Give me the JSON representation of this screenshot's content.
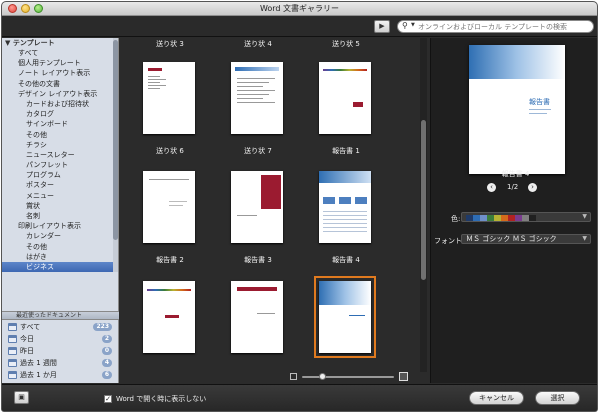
{
  "window": {
    "title": "Word 文書ギャラリー"
  },
  "toolbar": {
    "view_button_icon": "slideshow-icon",
    "search_placeholder": "オンラインおよびローカル テンプレートの検索"
  },
  "sidebar": {
    "header": "テンプレート",
    "items": [
      {
        "label": "すべて",
        "level": 1
      },
      {
        "label": "個人用テンプレート",
        "level": 1
      },
      {
        "label": "ノート レイアウト表示",
        "level": 1
      },
      {
        "label": "その他の文書",
        "level": 1
      },
      {
        "label": "デザイン レイアウト表示",
        "level": 1
      },
      {
        "label": "カードおよび招待状",
        "level": 2
      },
      {
        "label": "カタログ",
        "level": 2
      },
      {
        "label": "サインボード",
        "level": 2
      },
      {
        "label": "その他",
        "level": 2
      },
      {
        "label": "チラシ",
        "level": 2
      },
      {
        "label": "ニュースレター",
        "level": 2
      },
      {
        "label": "パンフレット",
        "level": 2
      },
      {
        "label": "プログラム",
        "level": 2
      },
      {
        "label": "ポスター",
        "level": 2
      },
      {
        "label": "メニュー",
        "level": 2
      },
      {
        "label": "賞状",
        "level": 2
      },
      {
        "label": "名刺",
        "level": 2
      },
      {
        "label": "印刷レイアウト表示",
        "level": 1
      },
      {
        "label": "カレンダー",
        "level": 2
      },
      {
        "label": "その他",
        "level": 2
      },
      {
        "label": "はがき",
        "level": 2
      },
      {
        "label": "ビジネス",
        "level": 2,
        "selected": true
      }
    ],
    "recent_header": "最近使ったドキュメント",
    "recent": [
      {
        "label": "すべて",
        "count": "223"
      },
      {
        "label": "今日",
        "count": "2"
      },
      {
        "label": "昨日",
        "count": "0"
      },
      {
        "label": "過去 1 週間",
        "count": "4"
      },
      {
        "label": "過去 1 か月",
        "count": "6"
      }
    ]
  },
  "gallery": {
    "top_labels": [
      "送り状 3",
      "送り状 4",
      "送り状 5"
    ],
    "rows": [
      [
        "送り状 6",
        "送り状 7",
        "報告書 1"
      ],
      [
        "報告書 2",
        "報告書 3",
        "報告書 4"
      ]
    ],
    "selected": "報告書 4"
  },
  "preview": {
    "page_title": "報告書",
    "name": "報告書 4",
    "page_indicator": "1/2",
    "color_label": "色:",
    "font_label": "フォント:",
    "font_value": "ＭＳ ゴシック ＭＳ ゴシック",
    "swatch_colors": [
      "#1f3a68",
      "#2e6db4",
      "#6f8fc9",
      "#3b7d3a",
      "#b8b233",
      "#d46a1b",
      "#b22222",
      "#7a3c8f",
      "#808080",
      "#202020"
    ]
  },
  "bottom": {
    "checkbox_label": "Word で開く時に表示しない",
    "checkbox_checked": true,
    "cancel": "キャンセル",
    "choose": "選択"
  },
  "colors": {
    "accent_selection": "#e07a1f",
    "sidebar_selected": "#3d67b2",
    "cover_red": "#9b1b30",
    "cover_blue": "#3b7ec4"
  }
}
